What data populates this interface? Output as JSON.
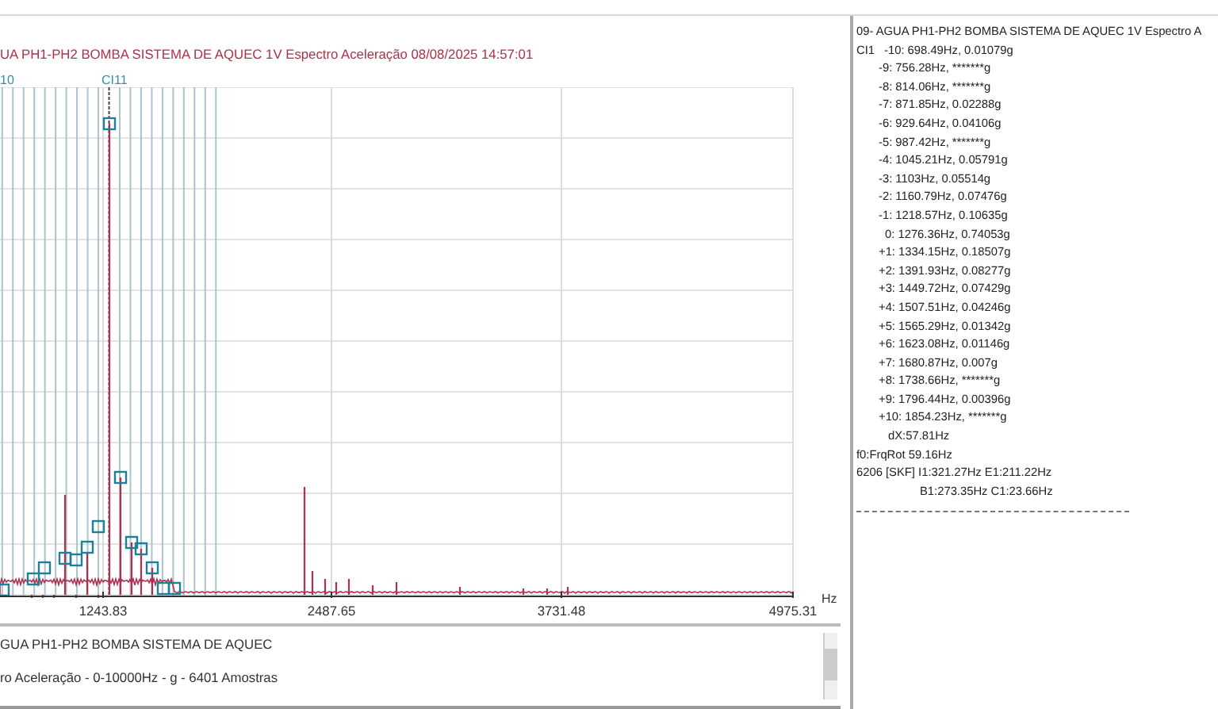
{
  "header": {
    "title": "UA PH1-PH2 BOMBA SISTEMA DE AQUEC 1V Espectro Aceleração 08/08/2025 14:57:01",
    "cursor_labels": [
      "10",
      "CI11"
    ]
  },
  "plot": {
    "x_tick_labels": [
      "1243.83",
      "2487.65",
      "3731.48",
      "4975.31"
    ],
    "unit": "Hz"
  },
  "info": {
    "lines": [
      "GUA PH1-PH2 BOMBA SISTEMA DE AQUEC",
      "ro Aceleração - 0-10000Hz - g - 6401 Amostras"
    ]
  },
  "panel": {
    "lines": [
      {
        "kind": "head",
        "text": "09- AGUA PH1-PH2 BOMBA SISTEMA DE AQUEC 1V Espectro A"
      },
      {
        "kind": "cursor",
        "label": "CI1",
        "text": "-10: 698.49Hz, 0.01079g"
      },
      {
        "kind": "harmonic",
        "text": "-9: 756.28Hz, *******g"
      },
      {
        "kind": "harmonic",
        "text": "-8: 814.06Hz, *******g"
      },
      {
        "kind": "harmonic",
        "text": "-7: 871.85Hz, 0.02288g"
      },
      {
        "kind": "harmonic",
        "text": "-6: 929.64Hz, 0.04106g"
      },
      {
        "kind": "harmonic",
        "text": "-5: 987.42Hz, *******g"
      },
      {
        "kind": "harmonic",
        "text": "-4: 1045.21Hz, 0.05791g"
      },
      {
        "kind": "harmonic",
        "text": "-3: 1103Hz, 0.05514g"
      },
      {
        "kind": "harmonic",
        "text": "-2: 1160.79Hz, 0.07476g"
      },
      {
        "kind": "harmonic",
        "text": "-1: 1218.57Hz, 0.10635g"
      },
      {
        "kind": "center",
        "text": "0: 1276.36Hz, 0.74053g"
      },
      {
        "kind": "harmonic",
        "text": "+1: 1334.15Hz, 0.18507g"
      },
      {
        "kind": "harmonic",
        "text": "+2: 1391.93Hz, 0.08277g"
      },
      {
        "kind": "harmonic",
        "text": "+3: 1449.72Hz, 0.07429g"
      },
      {
        "kind": "harmonic",
        "text": "+4: 1507.51Hz, 0.04246g"
      },
      {
        "kind": "harmonic",
        "text": "+5: 1565.29Hz, 0.01342g"
      },
      {
        "kind": "harmonic",
        "text": "+6: 1623.08Hz, 0.01146g"
      },
      {
        "kind": "harmonic",
        "text": "+7: 1680.87Hz, 0.007g"
      },
      {
        "kind": "harmonic",
        "text": "+8: 1738.66Hz, *******g"
      },
      {
        "kind": "harmonic",
        "text": "+9: 1796.44Hz, 0.00396g"
      },
      {
        "kind": "harmonic",
        "text": "+10: 1854.23Hz, *******g"
      },
      {
        "kind": "dx",
        "text": "dX:57.81Hz"
      },
      {
        "kind": "plain",
        "text": "f0:FrqRot 59.16Hz"
      },
      {
        "kind": "plain",
        "text": "6206 [SKF] I1:321.27Hz E1:211.22Hz"
      },
      {
        "kind": "cont",
        "text": "B1:273.35Hz C1:23.66Hz"
      }
    ]
  }
}
